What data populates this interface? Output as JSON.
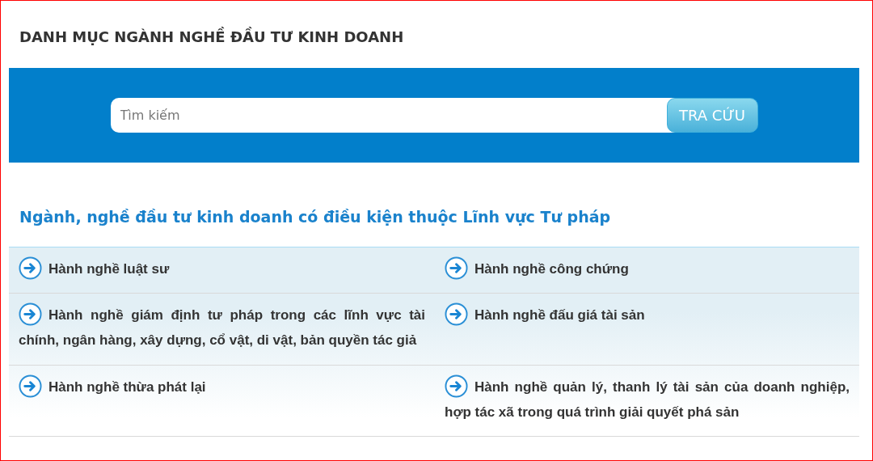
{
  "page_title": "DANH MỤC NGÀNH NGHỀ ĐẦU TƯ KINH DOANH",
  "search": {
    "placeholder": "Tìm kiếm",
    "button": "TRA CỨU"
  },
  "section_title": "Ngành, nghề đầu tư kinh doanh có điều kiện thuộc Lĩnh vực Tư pháp",
  "items": [
    {
      "label": "Hành nghề luật sư"
    },
    {
      "label": "Hành nghề công chứng"
    },
    {
      "label": "Hành nghề giám định tư pháp trong các lĩnh vực tài chính, ngân hàng, xây dựng, cổ vật, di vật, bản quyền tác giả"
    },
    {
      "label": "Hành nghề đấu giá tài sản"
    },
    {
      "label": "Hành nghề thừa phát lại"
    },
    {
      "label": "Hành nghề quản lý, thanh lý tài sản của doanh nghiệp, hợp tác xã trong quá trình giải quyết phá sản"
    }
  ]
}
